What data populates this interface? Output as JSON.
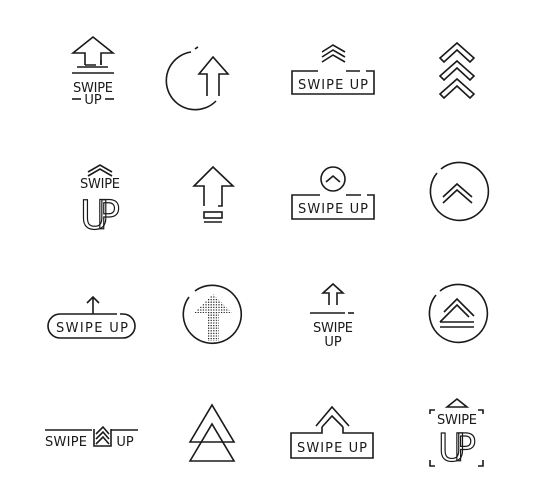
{
  "icon_set": {
    "line_color": "#1a1a1a",
    "background": "#ffffff",
    "icons": [
      {
        "name": "house-arrow-swipe-up",
        "line1": "SWIPE",
        "line2": "UP"
      },
      {
        "name": "circle-arrow-up"
      },
      {
        "name": "chevrons-box-swipe-up",
        "label": "SWIPE UP"
      },
      {
        "name": "triple-chevron-up"
      },
      {
        "name": "chevron-swipe-big-up",
        "line1": "SWIPE",
        "line2": "UP"
      },
      {
        "name": "arrow-up-with-bars"
      },
      {
        "name": "circle-chevron-box-swipe-up",
        "label": "SWIPE UP"
      },
      {
        "name": "circle-double-chevron-up"
      },
      {
        "name": "pill-arrow-swipe-up",
        "label": "SWIPE UP"
      },
      {
        "name": "circle-dotted-arrow-up"
      },
      {
        "name": "arrow-line-swipe-up",
        "line1": "SWIPE",
        "line2": "UP"
      },
      {
        "name": "circle-triangle-up"
      },
      {
        "name": "inline-chevron-swipe-up",
        "left": "SWIPE",
        "right": "UP"
      },
      {
        "name": "double-triangle-up"
      },
      {
        "name": "house-chevron-box-swipe-up",
        "label": "SWIPE UP"
      },
      {
        "name": "bracket-frame-swipe-up",
        "line1": "SWIPE",
        "line2": "UP"
      }
    ]
  }
}
